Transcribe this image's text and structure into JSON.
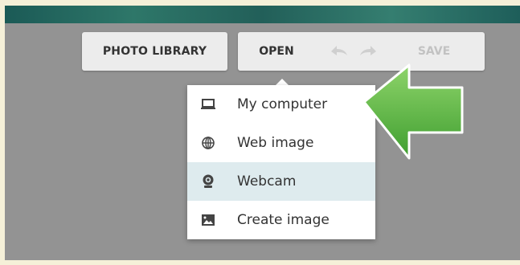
{
  "toolbar": {
    "photo_library_label": "PHOTO LIBRARY",
    "open_label": "OPEN",
    "save_label": "SAVE"
  },
  "icons": {
    "undo": "undo-icon",
    "redo": "redo-icon",
    "arrow": "green-arrow-icon"
  },
  "open_menu": {
    "items": [
      {
        "label": "My computer",
        "icon": "laptop-icon"
      },
      {
        "label": "Web image",
        "icon": "globe-icon"
      },
      {
        "label": "Webcam",
        "icon": "webcam-icon",
        "selected": true
      },
      {
        "label": "Create image",
        "icon": "image-icon"
      }
    ]
  },
  "colors": {
    "background": "#939393",
    "selected_item": "#deebee",
    "arrow": "#5db84a"
  }
}
